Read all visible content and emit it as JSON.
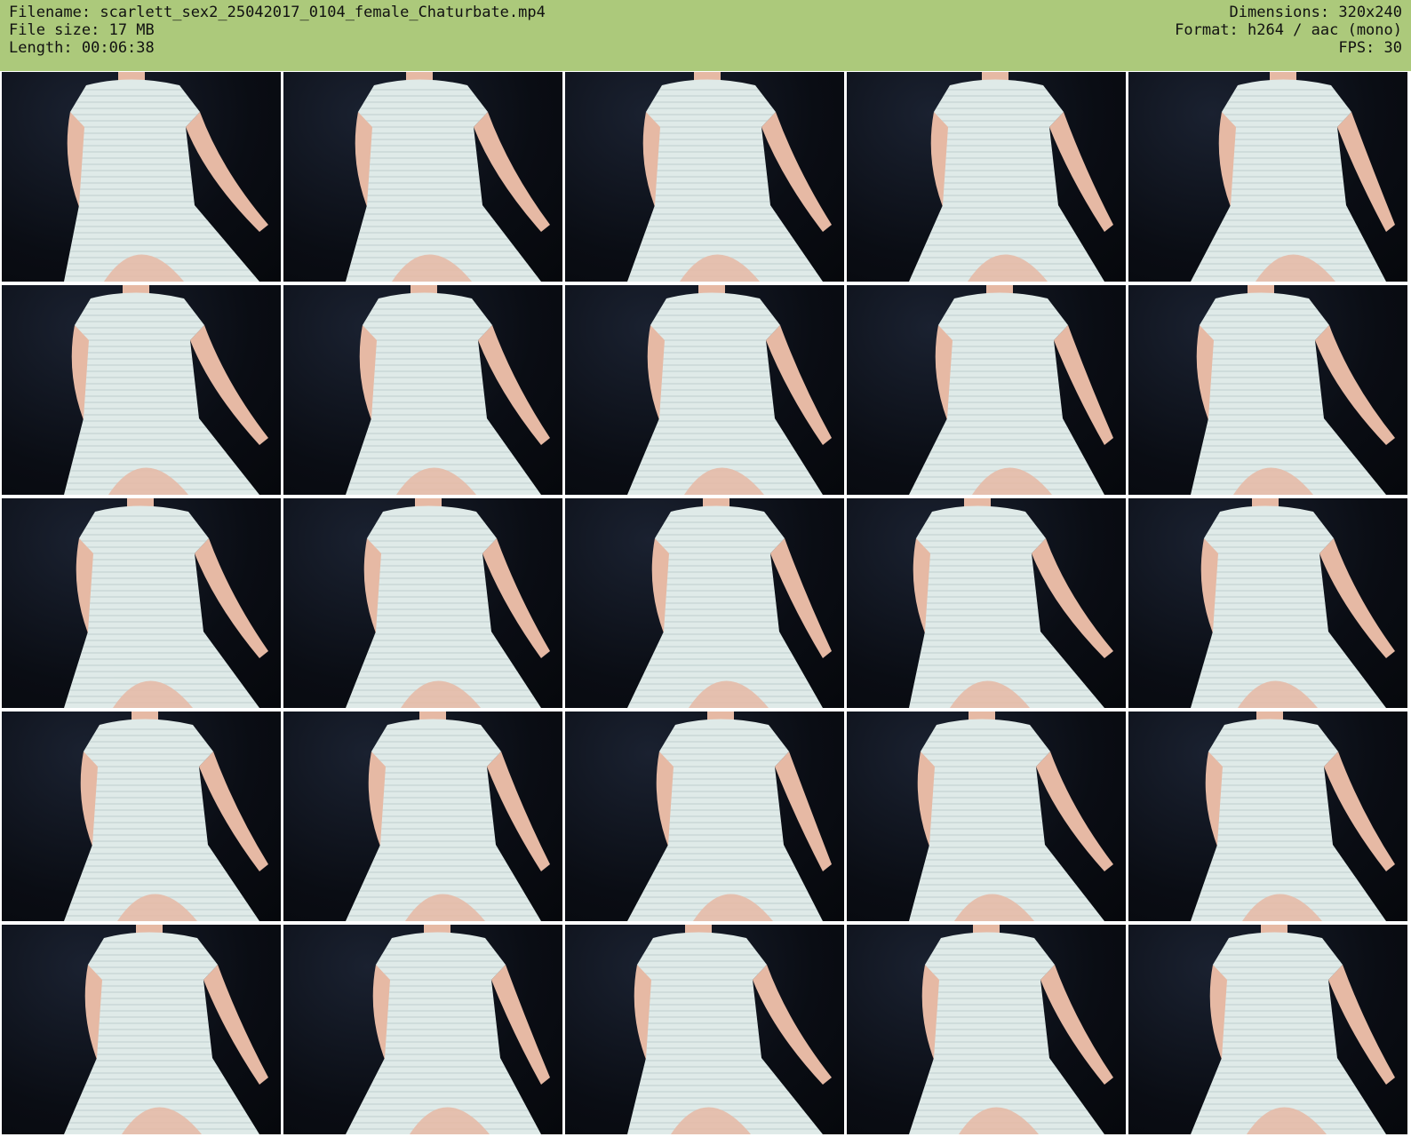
{
  "header": {
    "left": [
      "Filename: scarlett_sex2_25042017_0104_female_Chaturbate.mp4",
      "File size: 17 MB",
      "Length: 00:06:38"
    ],
    "right": [
      "Dimensions: 320x240",
      "Format: h264 / aac (mono)",
      "FPS: 30"
    ]
  },
  "colors": {
    "header_bg": "#acc97b",
    "thumbnail_bg": "#0a0d14",
    "dress": "#dfeae8",
    "stripe": "#b8c7c9",
    "skin": "#e6b9a4",
    "watermark": "#e8d84a"
  },
  "thumbnail_count": 25
}
